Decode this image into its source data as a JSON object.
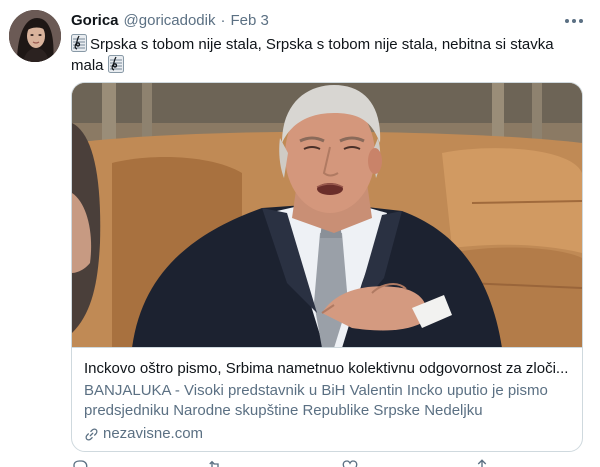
{
  "tweet": {
    "author_name": "Gorica",
    "author_handle": "@goricadodik",
    "separator": "·",
    "date": "Feb 3",
    "text_line1": "Srpska s tobom nije stala, Srpska s tobom nije stala, nebitna si stavka",
    "text_line2": "mala",
    "emoji": "music-score-emoji"
  },
  "card": {
    "title": "Inckovo oštro pismo, Srbima nametnuo kolektivnu odgovornost za zloči...",
    "description": "BANJALUKA - Visoki predstavnik u BiH Valentin Incko uputio je pismo predsjedniku Narodne skupštine Republike Srpske Nedeljku Čubrilovicu...",
    "domain": "nezavisne.com",
    "link_icon": "link-icon"
  },
  "colors": {
    "text_primary": "#0f1419",
    "text_secondary": "#5b7083",
    "border": "#cfd9de"
  }
}
